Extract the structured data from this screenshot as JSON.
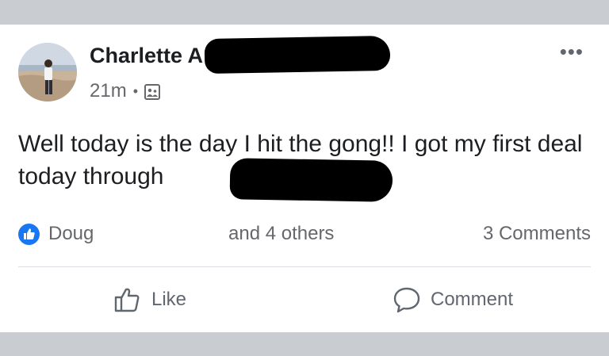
{
  "post": {
    "author_name": "Charlette A",
    "time": "21m",
    "separator": "•",
    "audience_icon": "audience-icon",
    "more_label": "•••",
    "text": "Well today is the day I hit the gong!! I got my first deal today through",
    "reactions": {
      "icon": "like-reaction-icon",
      "name": "Doug",
      "others": "and 4 others",
      "comments": "3 Comments"
    },
    "actions": {
      "like_label": "Like",
      "comment_label": "Comment"
    }
  },
  "colors": {
    "background": "#c9ccd1",
    "card": "#ffffff",
    "like_blue": "#1877f2",
    "secondary_text": "#65676b",
    "primary_text": "#1c1e21"
  }
}
